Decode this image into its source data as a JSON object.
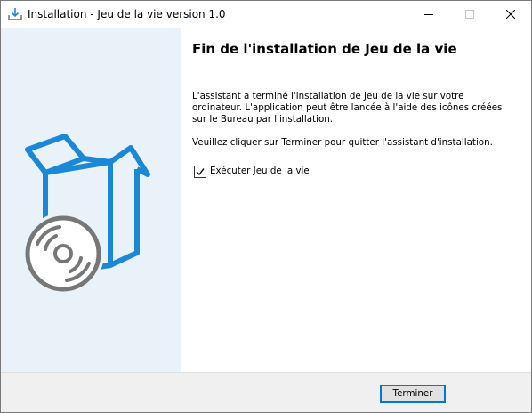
{
  "window": {
    "title": "Installation - Jeu de la vie version 1.0",
    "icon": "installer-icon",
    "controls": [
      "minimize-icon",
      "maximize-icon",
      "close-icon"
    ]
  },
  "content": {
    "heading": "Fin de l'installation de Jeu de la vie",
    "paragraph1": "L'assistant a terminé l'installation de Jeu de la vie sur votre ordinateur. L'application peut être lancée à l'aide des icônes créées sur le Bureau par l'installation.",
    "paragraph2": "Veuillez cliquer sur Terminer pour quitter l'assistant d'installation.",
    "checkbox": {
      "label": "Exécuter Jeu de la vie",
      "checked": true
    }
  },
  "side_art": {
    "icon": "box-disc-icon",
    "box_color": "#1a88d6",
    "disc_color": "#777777"
  },
  "footer": {
    "finish_label": "Terminer"
  },
  "colors": {
    "side_panel": "#e9f1f9",
    "accent": "#0078d7",
    "footer": "#f0f0f0"
  }
}
